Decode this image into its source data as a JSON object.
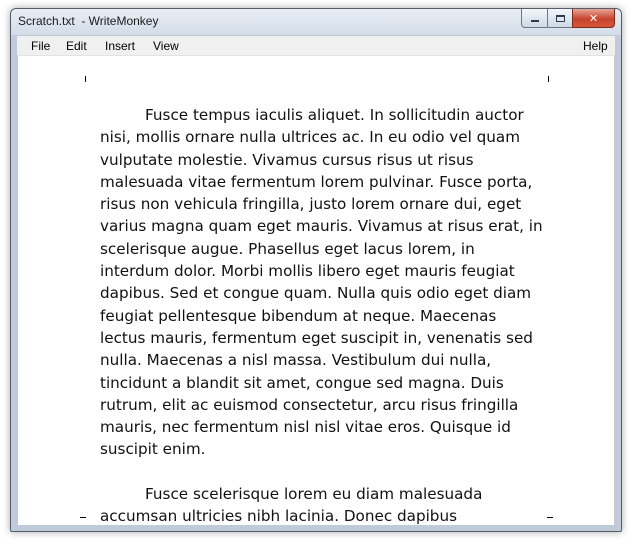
{
  "window": {
    "title": "Scratch.txt  - WriteMonkey",
    "close_glyph": "✕"
  },
  "menubar": {
    "file": "File",
    "edit": "Edit",
    "insert": "Insert",
    "view": "View",
    "help": "Help"
  },
  "document": {
    "paragraphs": [
      "Fusce tempus iaculis aliquet. In sollicitudin auctor nisi, mollis ornare nulla ultrices ac. In eu odio vel quam vulputate molestie. Vivamus cursus risus ut risus malesuada vitae fermentum lorem pulvinar. Fusce porta, risus non vehicula fringilla, justo lorem ornare dui, eget varius magna quam eget mauris. Vivamus at risus erat, in scelerisque augue. Phasellus eget lacus lorem, in interdum dolor. Morbi mollis libero eget mauris feugiat dapibus. Sed et congue quam. Nulla quis odio eget diam feugiat pellentesque bibendum at neque. Maecenas lectus mauris, fermentum eget suscipit in, venenatis sed nulla. Maecenas a nisl massa. Vestibulum dui nulla, tincidunt a blandit sit amet, congue sed magna. Duis rutrum, elit ac euismod consectetur, arcu risus fringilla mauris, nec fermentum nisl nisl vitae eros. Quisque id suscipit enim.",
      "Fusce scelerisque lorem eu diam malesuada accumsan ultricies nibh lacinia. Donec dapibus"
    ]
  },
  "colors": {
    "window_frame": "#bfcbd9",
    "close_button": "#c7442c",
    "menubar_bg": "#f0f0f0",
    "page_bg": "#ffffff",
    "text": "#111111"
  }
}
